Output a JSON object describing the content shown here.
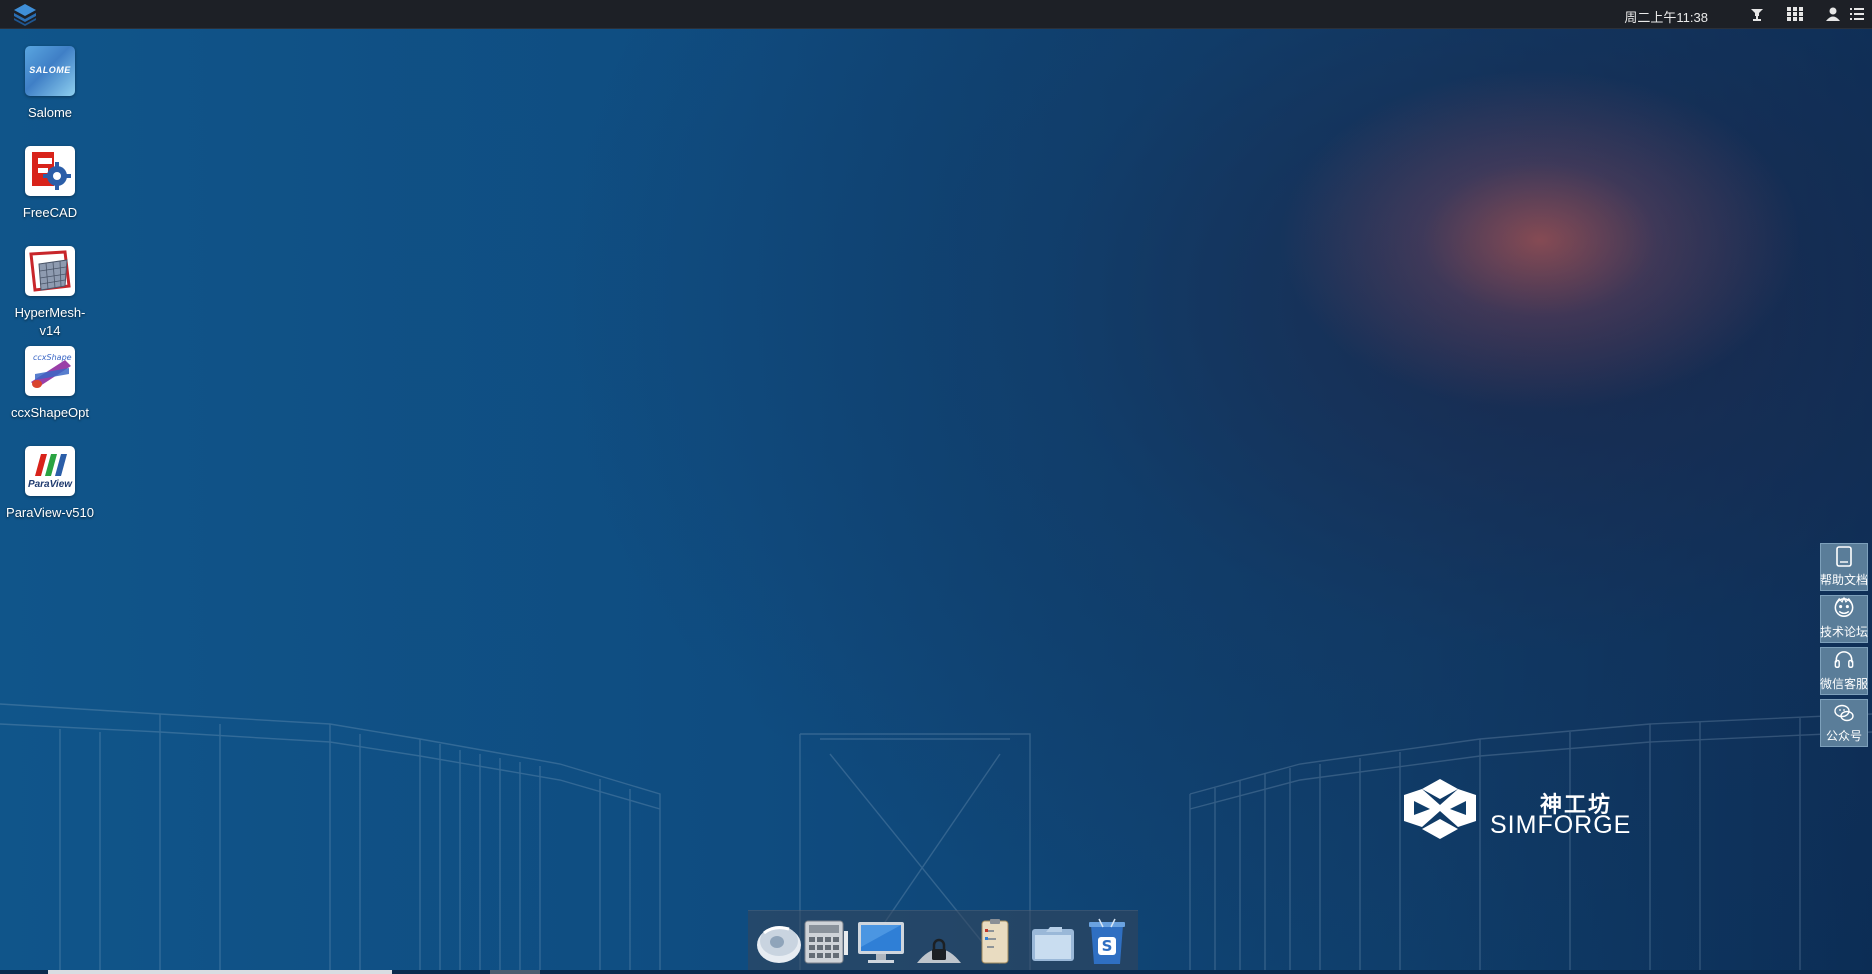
{
  "top_panel": {
    "clock": "周二上午11:38",
    "icons": [
      "app-menu-icon",
      "network-icon",
      "apps-grid-icon",
      "user-icon",
      "menu-icon"
    ]
  },
  "desktop_icons": [
    {
      "label": "Salome",
      "icon": "salome-icon",
      "tile_text": "SALOME"
    },
    {
      "label": "FreeCAD",
      "icon": "freecad-icon"
    },
    {
      "label": "HyperMesh-v14",
      "icon": "hypermesh-icon"
    },
    {
      "label": "ccxShapeOpt",
      "icon": "ccxshapeopt-icon"
    },
    {
      "label": "ParaView-v510",
      "icon": "paraview-icon",
      "tile_text": "ParaView"
    }
  ],
  "side_panel": [
    {
      "label": "帮助文档",
      "icon": "document-icon"
    },
    {
      "label": "技术论坛",
      "icon": "forum-icon"
    },
    {
      "label": "微信客服",
      "icon": "headset-icon"
    },
    {
      "label": "公众号",
      "icon": "wechat-icon"
    }
  ],
  "brand": {
    "cn": "神工坊",
    "en": "SIMFORGE"
  },
  "dock": [
    {
      "icon": "disk-icon"
    },
    {
      "icon": "calculator-icon"
    },
    {
      "icon": "monitor-icon"
    },
    {
      "icon": "lock-icon"
    },
    {
      "icon": "notes-icon"
    },
    {
      "icon": "folder-icon"
    },
    {
      "icon": "trash-icon"
    }
  ],
  "colors": {
    "panel": "#1d2026",
    "side_button": "#5a7d99",
    "wallpaper": "#0f4877"
  }
}
